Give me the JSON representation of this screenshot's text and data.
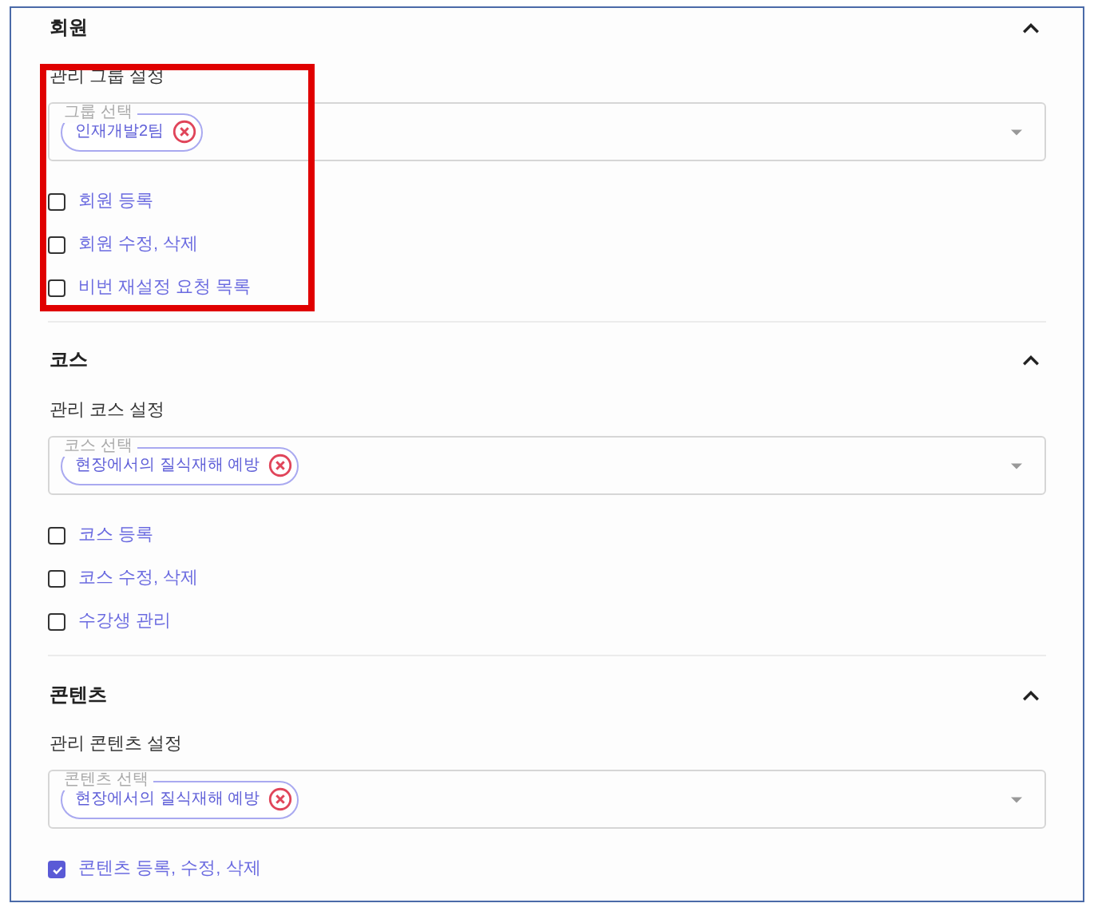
{
  "sections": [
    {
      "title": "회원",
      "expanded": true,
      "highlighted": true,
      "field_label": "관리 그룹 설정",
      "select": {
        "legend": "그룹 선택",
        "chips": [
          "인재개발2팀"
        ]
      },
      "permissions": [
        {
          "label": "회원 등록",
          "checked": false
        },
        {
          "label": "회원 수정, 삭제",
          "checked": false
        },
        {
          "label": "비번 재설정 요청 목록",
          "checked": false
        }
      ]
    },
    {
      "title": "코스",
      "expanded": true,
      "highlighted": false,
      "field_label": "관리 코스 설정",
      "select": {
        "legend": "코스 선택",
        "chips": [
          "현장에서의 질식재해 예방"
        ]
      },
      "permissions": [
        {
          "label": "코스 등록",
          "checked": false
        },
        {
          "label": "코스 수정, 삭제",
          "checked": false
        },
        {
          "label": "수강생 관리",
          "checked": false
        }
      ]
    },
    {
      "title": "콘텐츠",
      "expanded": true,
      "highlighted": false,
      "field_label": "관리 콘텐츠 설정",
      "select": {
        "legend": "콘텐츠 선택",
        "chips": [
          "현장에서의 질식재해 예방"
        ]
      },
      "permissions": [
        {
          "label": "콘텐츠 등록, 수정, 삭제",
          "checked": true
        }
      ]
    }
  ]
}
